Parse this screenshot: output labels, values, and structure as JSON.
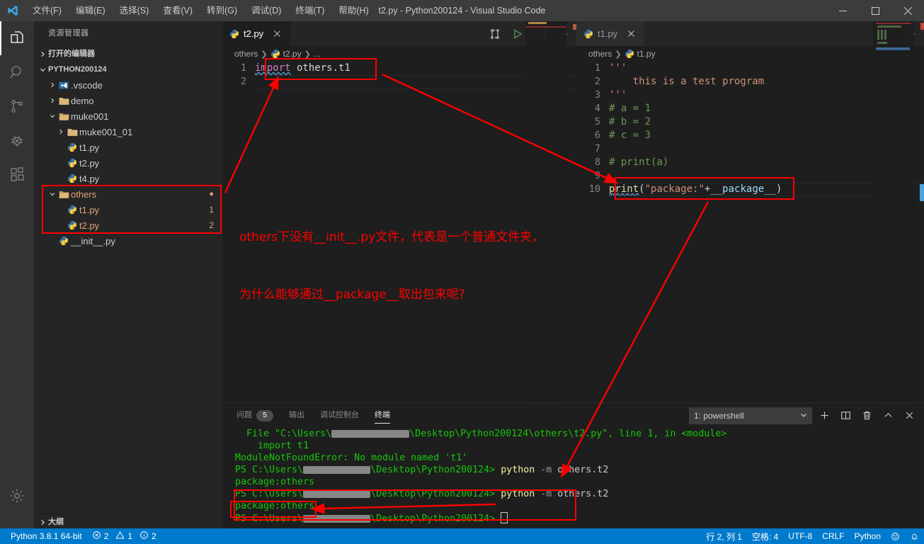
{
  "window": {
    "title": "t2.py - Python200124 - Visual Studio Code",
    "minimize_label": "minimize",
    "maximize_label": "maximize",
    "close_label": "close"
  },
  "menu": {
    "items": [
      {
        "label": "文件(F)"
      },
      {
        "label": "编辑(E)"
      },
      {
        "label": "选择(S)"
      },
      {
        "label": "查看(V)"
      },
      {
        "label": "转到(G)"
      },
      {
        "label": "调试(D)"
      },
      {
        "label": "终端(T)"
      },
      {
        "label": "帮助(H)"
      }
    ]
  },
  "activitybar": {
    "items": [
      {
        "name": "explorer",
        "icon": "files-icon"
      },
      {
        "name": "search",
        "icon": "search-icon"
      },
      {
        "name": "source-control",
        "icon": "branch-icon"
      },
      {
        "name": "debug",
        "icon": "bug-icon"
      },
      {
        "name": "extensions",
        "icon": "extensions-icon"
      }
    ],
    "settings_icon": "gear-icon"
  },
  "sidebar": {
    "title": "资源管理器",
    "open_editors_label": "打开的编辑器",
    "project_label": "PYTHON200124",
    "outline_label": "大纲",
    "tree": [
      {
        "label": ".vscode",
        "type": "folder",
        "indent": 1,
        "expanded": false,
        "icon": "vscode-folder-icon",
        "deco": ""
      },
      {
        "label": "demo",
        "type": "folder",
        "indent": 1,
        "expanded": false,
        "icon": "folder-icon",
        "deco": ""
      },
      {
        "label": "muke001",
        "type": "folder",
        "indent": 1,
        "expanded": true,
        "icon": "folder-open-icon",
        "deco": ""
      },
      {
        "label": "muke001_01",
        "type": "folder",
        "indent": 2,
        "expanded": false,
        "icon": "folder-icon",
        "deco": ""
      },
      {
        "label": "t1.py",
        "type": "file",
        "indent": 2,
        "icon": "python-icon",
        "deco": ""
      },
      {
        "label": "t2.py",
        "type": "file",
        "indent": 2,
        "icon": "python-icon",
        "deco": ""
      },
      {
        "label": "t4.py",
        "type": "file",
        "indent": 2,
        "icon": "python-icon",
        "deco": ""
      },
      {
        "label": "others",
        "type": "folder",
        "indent": 1,
        "expanded": true,
        "icon": "folder-open-icon",
        "deco": "●",
        "modified": true
      },
      {
        "label": "t1.py",
        "type": "file",
        "indent": 2,
        "icon": "python-icon",
        "deco": "1",
        "modified": true
      },
      {
        "label": "t2.py",
        "type": "file",
        "indent": 2,
        "icon": "python-icon",
        "deco": "2",
        "modified": true
      },
      {
        "label": "__init__.py",
        "type": "file",
        "indent": 1,
        "icon": "python-icon",
        "deco": ""
      }
    ]
  },
  "editor_left": {
    "tab_label": "t2.py",
    "breadcrumb": [
      "others",
      "t2.py",
      "..."
    ],
    "actions": [
      "split-compare-icon",
      "run-icon",
      "split-editor-icon",
      "more-actions-icon"
    ],
    "lines": [
      {
        "n": "1",
        "tokens": [
          {
            "t": "import",
            "c": "k-kw squig"
          },
          {
            "t": " others.t1",
            "c": "k-plain"
          }
        ]
      },
      {
        "n": "2",
        "tokens": [
          {
            "t": "",
            "c": "k-plain"
          }
        ]
      }
    ]
  },
  "editor_right": {
    "tab_label": "t1.py",
    "breadcrumb": [
      "others",
      "t1.py"
    ],
    "actions": [
      "more-actions-icon"
    ],
    "lines": [
      {
        "n": "1",
        "tokens": [
          {
            "t": "'''",
            "c": "k-str"
          }
        ]
      },
      {
        "n": "2",
        "tokens": [
          {
            "t": "    this is a test program",
            "c": "k-str"
          }
        ]
      },
      {
        "n": "3",
        "tokens": [
          {
            "t": "'''",
            "c": "k-str"
          }
        ]
      },
      {
        "n": "4",
        "tokens": [
          {
            "t": "# a = 1",
            "c": "k-com"
          }
        ]
      },
      {
        "n": "5",
        "tokens": [
          {
            "t": "# b = 2",
            "c": "k-com"
          }
        ]
      },
      {
        "n": "6",
        "tokens": [
          {
            "t": "# c = 3",
            "c": "k-com"
          }
        ]
      },
      {
        "n": "7",
        "tokens": [
          {
            "t": "",
            "c": "k-plain"
          }
        ]
      },
      {
        "n": "8",
        "tokens": [
          {
            "t": "# print(a)",
            "c": "k-com"
          }
        ]
      },
      {
        "n": "9",
        "tokens": [
          {
            "t": "",
            "c": "k-plain"
          }
        ]
      },
      {
        "n": "10",
        "tokens": [
          {
            "t": "print",
            "c": "k-fn squig"
          },
          {
            "t": "(",
            "c": "k-plain"
          },
          {
            "t": "\"package:\"",
            "c": "k-str"
          },
          {
            "t": "+",
            "c": "k-plain"
          },
          {
            "t": "__package__",
            "c": "k-id"
          },
          {
            "t": ")",
            "c": "k-plain"
          }
        ]
      }
    ]
  },
  "panel": {
    "tabs": [
      {
        "label": "问题",
        "badge": "5",
        "active": false
      },
      {
        "label": "输出",
        "badge": "",
        "active": false
      },
      {
        "label": "调试控制台",
        "badge": "",
        "active": false
      },
      {
        "label": "终端",
        "badge": "",
        "active": true
      }
    ],
    "terminal_select": "1: powershell",
    "actions": [
      "new-terminal-icon",
      "split-terminal-icon",
      "kill-terminal-icon",
      "maximize-panel-icon",
      "close-panel-icon"
    ],
    "terminal_lines": [
      {
        "segs": [
          {
            "t": "  File \"C:\\Users\\",
            "c": "t-grn"
          },
          {
            "t": "__REDACT_110__",
            "c": "redact"
          },
          {
            "t": "\\Desktop\\Python200124\\others\\t2.py\", line 1, in <module>",
            "c": "t-grn"
          }
        ]
      },
      {
        "segs": [
          {
            "t": "    import t1",
            "c": "t-grn"
          }
        ]
      },
      {
        "segs": [
          {
            "t": "ModuleNotFoundError: No module named 't1'",
            "c": "t-grn"
          }
        ]
      },
      {
        "segs": [
          {
            "t": "PS C:\\Users\\",
            "c": "t-grn"
          },
          {
            "t": "__REDACT_95__",
            "c": "redact"
          },
          {
            "t": "\\Desktop\\Python200124> ",
            "c": "t-grn"
          },
          {
            "t": "python ",
            "c": "t-yel"
          },
          {
            "t": "-m",
            "c": "t-gry"
          },
          {
            "t": " others.t2",
            "c": "t-wht"
          }
        ]
      },
      {
        "segs": [
          {
            "t": "package:others",
            "c": "t-grn"
          }
        ]
      },
      {
        "segs": [
          {
            "t": "PS C:\\Users\\",
            "c": "t-grn"
          },
          {
            "t": "__REDACT_95__",
            "c": "redact"
          },
          {
            "t": "\\Desktop\\Python200124> ",
            "c": "t-grn"
          },
          {
            "t": "python ",
            "c": "t-yel"
          },
          {
            "t": "-m",
            "c": "t-gry"
          },
          {
            "t": " others.t2",
            "c": "t-wht"
          }
        ]
      },
      {
        "segs": [
          {
            "t": "package:others",
            "c": "t-grn"
          }
        ]
      },
      {
        "segs": [
          {
            "t": "PS C:\\Users\\",
            "c": "t-grn"
          },
          {
            "t": "__REDACT_95__",
            "c": "redact"
          },
          {
            "t": "\\Desktop\\Python200124> ",
            "c": "t-grn"
          },
          {
            "t": "__CARET__",
            "c": "caret"
          }
        ]
      }
    ]
  },
  "statusbar": {
    "left": [
      {
        "label": "Python 3.8.1 64-bit",
        "icon": ""
      },
      {
        "label": "2",
        "icon": "error-icon"
      },
      {
        "label": "1",
        "icon": "warning-icon"
      },
      {
        "label": "2",
        "icon": "info-icon"
      }
    ],
    "right": [
      {
        "label": "行 2, 列 1",
        "icon": ""
      },
      {
        "label": "空格: 4",
        "icon": ""
      },
      {
        "label": "UTF-8",
        "icon": ""
      },
      {
        "label": "CRLF",
        "icon": ""
      },
      {
        "label": "Python",
        "icon": ""
      },
      {
        "label": "",
        "icon": "smiley-icon"
      },
      {
        "label": "",
        "icon": "bell-icon"
      }
    ]
  },
  "annotations": {
    "color": "#fe0000",
    "note_line1": "others下没有__init__.py文件，代表是一个普通文件夹，",
    "note_line2": "为什么能够通过__package__取出包来呢?"
  }
}
